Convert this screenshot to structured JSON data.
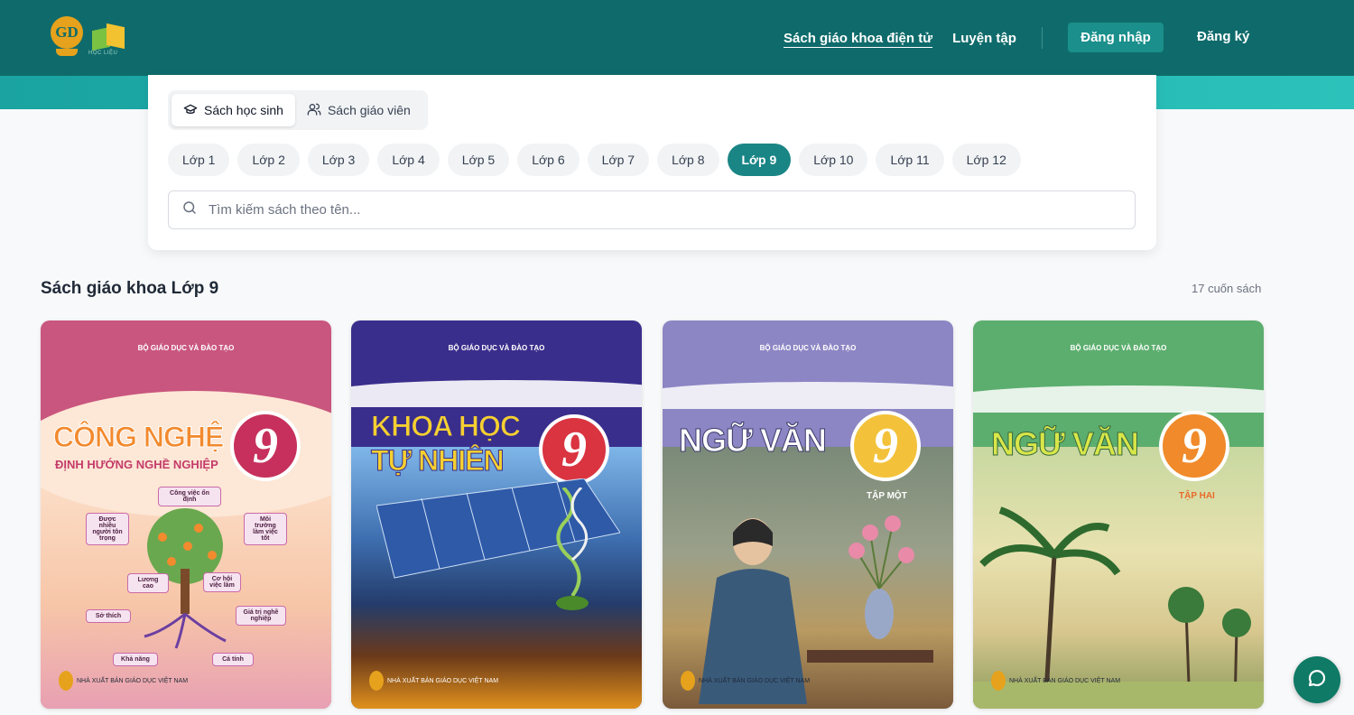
{
  "header": {
    "nav": [
      "Sách giáo khoa điện tử",
      "Luyện tập"
    ],
    "login": "Đăng nhập",
    "register": "Đăng ký",
    "colors": {
      "topbar": "#0f6b6b",
      "accent": "#1a8585"
    }
  },
  "filters": {
    "book_types": [
      "Sách học sinh",
      "Sách giáo viên"
    ],
    "selected_type": "Sách học sinh",
    "grades": [
      "Lớp 1",
      "Lớp 2",
      "Lớp 3",
      "Lớp 4",
      "Lớp 5",
      "Lớp 6",
      "Lớp 7",
      "Lớp 8",
      "Lớp 9",
      "Lớp 10",
      "Lớp 11",
      "Lớp 12"
    ],
    "selected_grade": "Lớp 9",
    "search_placeholder": "Tìm kiếm sách theo tên..."
  },
  "main": {
    "title": "Sách giáo khoa Lớp 9",
    "count": "17 cuốn sách"
  },
  "books": [
    {
      "ministry": "BỘ GIÁO DỤC VÀ ĐÀO TẠO",
      "title": "CÔNG NGHỆ",
      "subtitle": "ĐỊNH HƯỚNG NGHỀ NGHIỆP",
      "grade": "9",
      "volume": "",
      "labels": [
        "Công việc ổn định",
        "Được nhiều người tôn trọng",
        "Môi trường làm việc tốt",
        "Lương cao",
        "Cơ hội việc làm",
        "Sở thích",
        "Giá trị nghề nghiệp",
        "Khả năng",
        "Cá tính"
      ],
      "publisher": "NHÀ XUẤT BẢN GIÁO DỤC VIỆT NAM"
    },
    {
      "ministry": "BỘ GIÁO DỤC VÀ ĐÀO TẠO",
      "title": "KHOA HỌC TỰ NHIÊN",
      "subtitle": "",
      "grade": "9",
      "volume": "",
      "labels": [],
      "publisher": "NHÀ XUẤT BẢN GIÁO DỤC VIỆT NAM"
    },
    {
      "ministry": "BỘ GIÁO DỤC VÀ ĐÀO TẠO",
      "title": "NGỮ VĂN",
      "subtitle": "",
      "grade": "9",
      "volume": "TẬP MỘT",
      "labels": [],
      "publisher": "NHÀ XUẤT BẢN GIÁO DỤC VIỆT NAM"
    },
    {
      "ministry": "BỘ GIÁO DỤC VÀ ĐÀO TẠO",
      "title": "NGỮ VĂN",
      "subtitle": "",
      "grade": "9",
      "volume": "TẬP HAI",
      "labels": [],
      "publisher": "NHÀ XUẤT BẢN GIÁO DỤC VIỆT NAM"
    }
  ]
}
